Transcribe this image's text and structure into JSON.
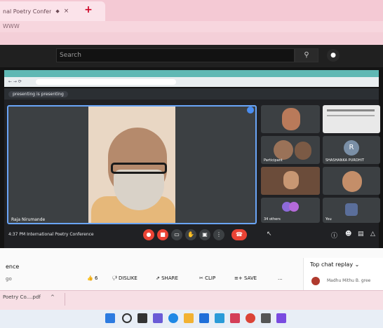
{
  "browser": {
    "tab_title": "nal Poetry Confer",
    "tab_close": "×",
    "new_tab": "+",
    "url": "WWW"
  },
  "youtube": {
    "search_placeholder": "Search",
    "search_icon": "search-icon",
    "mic_icon": "mic-icon"
  },
  "meet": {
    "presenting_banner": "presenting is presenting",
    "main_speaker": "Raja Nirumande",
    "tiles": [
      {
        "name": ""
      },
      {
        "name": ""
      },
      {
        "name": "Participant"
      },
      {
        "name": "SHASHANKA PUROHIT",
        "initial": "R"
      },
      {
        "name": ""
      },
      {
        "name": ""
      },
      {
        "name": "34 others"
      },
      {
        "name": "You"
      }
    ],
    "time_meeting": "4:37 PM  International Poetry Conference"
  },
  "video_page": {
    "title": "ence",
    "subtitle": "go",
    "like_count": "6",
    "actions": [
      "DISLIKE",
      "SHARE",
      "CLIP",
      "SAVE",
      "..."
    ],
    "chat_header": "Top chat replay",
    "chat_message": "Madhu Mithu B. gree"
  },
  "downloads": {
    "item": "Poetry Co....pdf",
    "chevron": "^"
  },
  "colors": {
    "tab_pink": "#f4c9d4",
    "meet_bg": "#202124",
    "end_call": "#ea4335",
    "youtube_dark": "#202020"
  }
}
